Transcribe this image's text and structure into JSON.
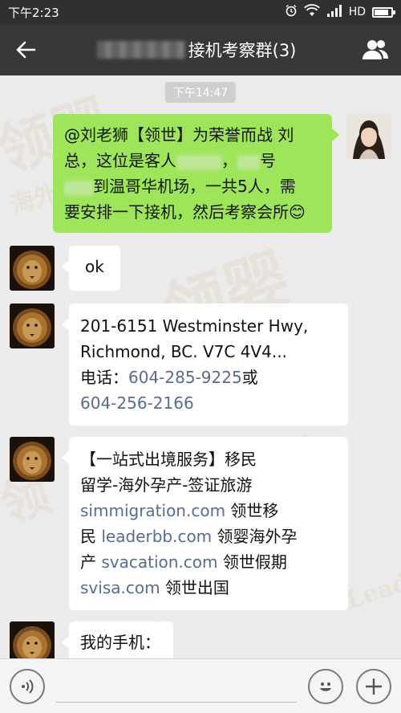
{
  "statusbar": {
    "time": "下午2:23",
    "network": "HD"
  },
  "header": {
    "title": "接机考察群(3)"
  },
  "chat": {
    "timestamp": "下午14:47",
    "outgoing": {
      "l1": "@刘老狮【领世】为荣誉而战 刘",
      "l2a": "总，这位是客人",
      "l2b": "，",
      "l2c": "号",
      "l3": "到温哥华机场，一共5人，需",
      "l4": "要安排一下接机，然后考察会所",
      "emoji": "😊"
    },
    "msg1": {
      "text": "ok"
    },
    "msg2": {
      "line1": "201-6151 Westminster Hwy,",
      "line2": "Richmond, BC. V7C 4V4...",
      "phone_label": "电话：",
      "phone1": "604-285-9225",
      "or": "或",
      "phone2": "604-256-2166"
    },
    "msg3": {
      "l1": "【一站式出境服务】移民",
      "l2": "留学-海外孕产-签证旅游",
      "link1": "simmigration.com",
      "t1": " 领世移",
      "t2": "民  ",
      "link2": "leaderbb.com",
      "t3": " 领婴海外孕",
      "t4": "产 ",
      "link3": "svacation.com",
      "t5": " 领世假期",
      "link4": "svisa.com",
      "t6": " 领世出国"
    },
    "msg4": {
      "text": "我的手机："
    }
  },
  "watermarks": [
    "领婴",
    "海外孕产",
    "LeaderBaby",
    "领",
    "Leader",
    "Baby"
  ],
  "colors": {
    "titlebar": "#383838",
    "out_bubble": "#9fe55a",
    "link": "#576b95"
  }
}
